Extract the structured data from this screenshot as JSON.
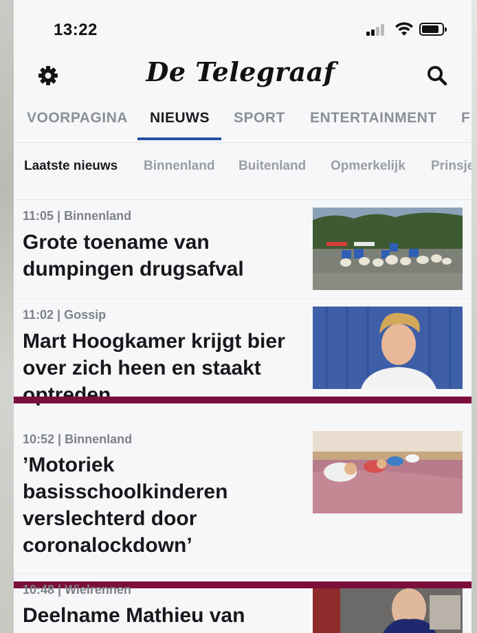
{
  "status": {
    "time": "13:22"
  },
  "header": {
    "logo": "De Telegraaf"
  },
  "tabs": [
    {
      "label": "VOORPAGINA"
    },
    {
      "label": "NIEUWS"
    },
    {
      "label": "SPORT"
    },
    {
      "label": "ENTERTAINMENT"
    },
    {
      "label": "F"
    }
  ],
  "subtabs": [
    {
      "label": "Laatste nieuws"
    },
    {
      "label": "Binnenland"
    },
    {
      "label": "Buitenland"
    },
    {
      "label": "Opmerkelijk"
    },
    {
      "label": "Prinsje"
    }
  ],
  "articles": [
    {
      "meta": "11:05 | Binnenland",
      "headline": "Grote toename van dumpingen drugsafval"
    },
    {
      "meta": "11:02 | Gossip",
      "headline": "Mart Hoogkamer krijgt bier over zich heen en staakt optreden"
    },
    {
      "meta": "10:52 | Binnenland",
      "headline": "’Motoriek basisschoolkinderen verslechterd door coronalockdown’"
    },
    {
      "meta": "10:48 | Wielrennen",
      "headline": "Deelname Mathieu van"
    }
  ],
  "colors": {
    "accent": "#2450a0",
    "divider": "#7d0e3c"
  }
}
